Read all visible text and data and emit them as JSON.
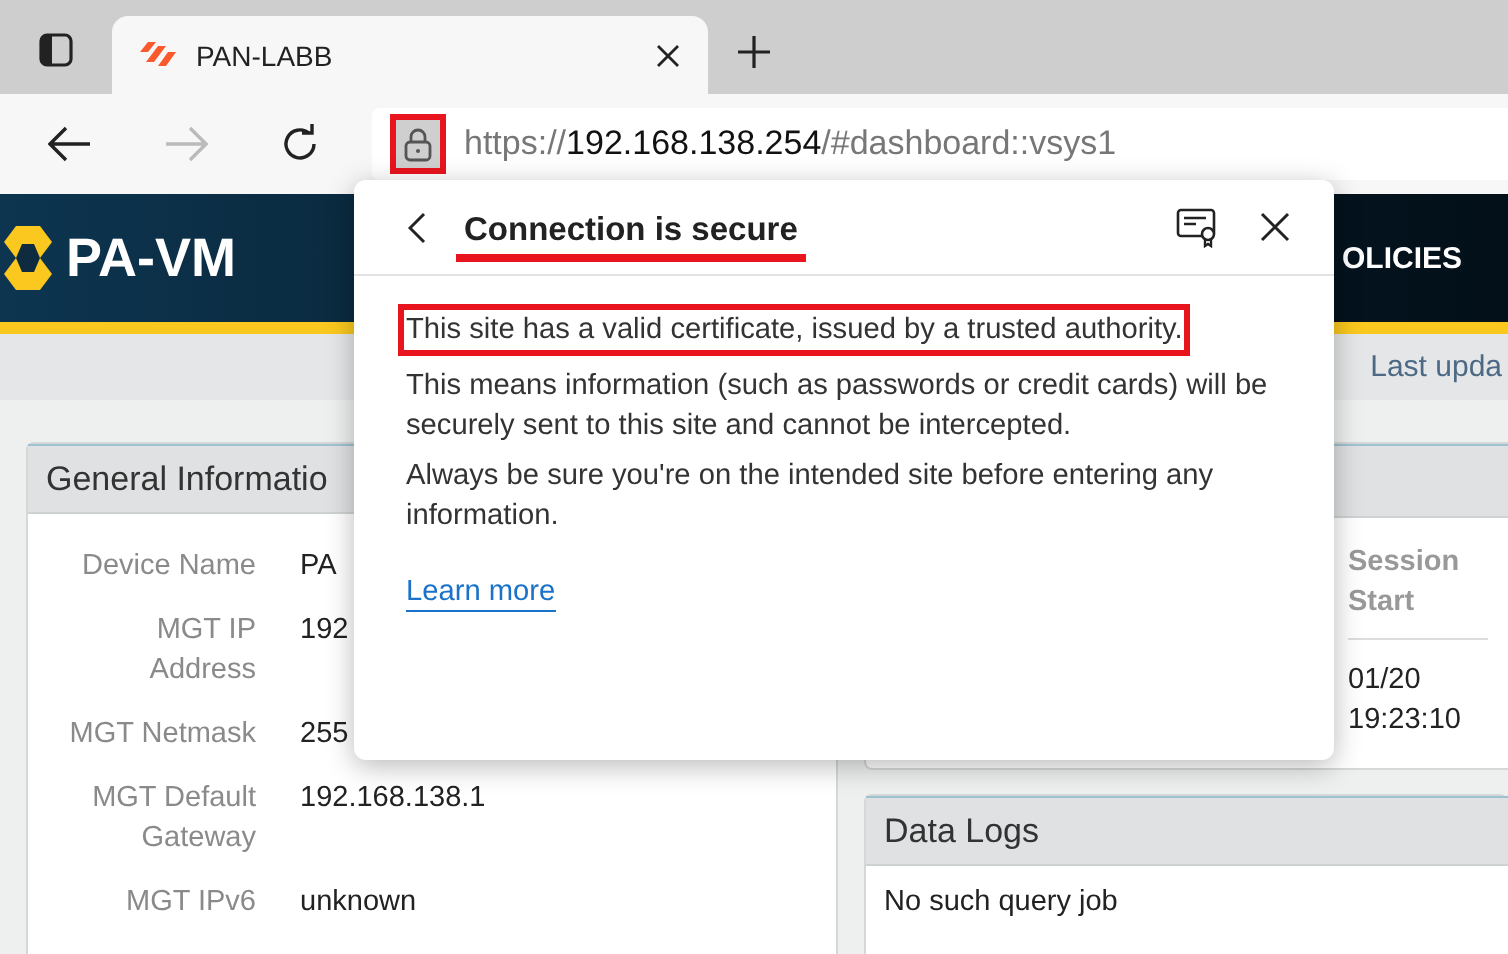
{
  "browser": {
    "tabs": [
      {
        "title": "PAN-LABB",
        "selected": true
      }
    ],
    "toolbar": {
      "back_disabled": false,
      "forward_disabled": true
    },
    "address_bar": {
      "scheme": "https://",
      "host": "192.168.138.254",
      "path": "/#dashboard::vsys1",
      "lock_highlighted": true
    }
  },
  "app_header": {
    "logo": "PA-VM",
    "nav_item": "OLICIES"
  },
  "sub_bar": {
    "text": "Last upda"
  },
  "general_information": {
    "title": "General Informatio",
    "rows": [
      {
        "label": "Device Name",
        "value": "PA"
      },
      {
        "label": "MGT IP Address",
        "value": "192"
      },
      {
        "label": "MGT Netmask",
        "value": "255"
      },
      {
        "label": "MGT Default Gateway",
        "value": "192.168.138.1"
      },
      {
        "label": "MGT IPv6",
        "value": "unknown"
      }
    ]
  },
  "session_table": {
    "columns": [
      "Session Start"
    ],
    "rows": [
      [
        "01/20 19:23:10"
      ]
    ]
  },
  "data_logs": {
    "title": "Data Logs",
    "message": "No such query job"
  },
  "popup": {
    "title": "Connection is secure",
    "title_highlighted": true,
    "lead": "This site has a valid certificate, issued by a trusted authority.",
    "lead_highlighted": true,
    "paragraphs": [
      "This means information (such as passwords or credit cards) will be securely sent to this site and cannot be intercepted.",
      "Always be sure you're on the intended site before entering any information."
    ],
    "link": "Learn more"
  }
}
